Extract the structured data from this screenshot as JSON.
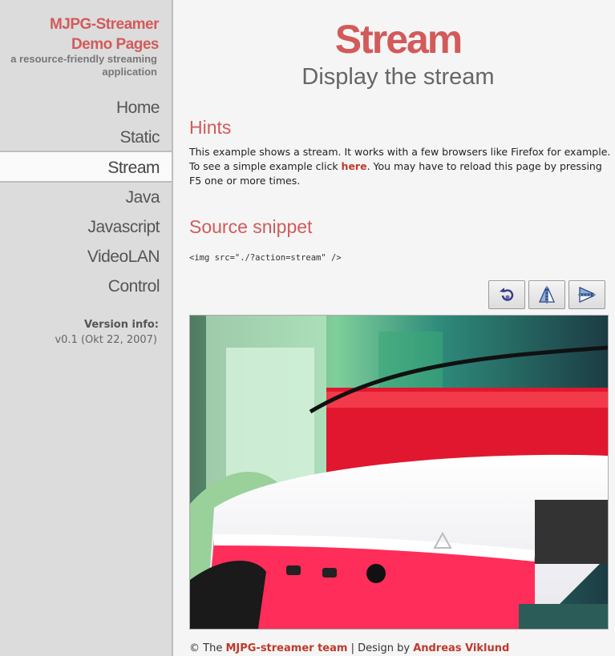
{
  "brand": {
    "title_line1": "MJPG-Streamer",
    "title_line2": "Demo Pages",
    "subtitle_line1": "a resource-friendly streaming",
    "subtitle_line2": "application"
  },
  "nav": {
    "items": [
      {
        "label": "Home"
      },
      {
        "label": "Static"
      },
      {
        "label": "Stream",
        "active": true
      },
      {
        "label": "Java"
      },
      {
        "label": "Javascript"
      },
      {
        "label": "VideoLAN"
      },
      {
        "label": "Control"
      }
    ]
  },
  "version": {
    "label": "Version info:",
    "value": "v0.1 (Okt 22, 2007)"
  },
  "page": {
    "title": "Stream",
    "subtitle": "Display the stream"
  },
  "hints": {
    "heading": "Hints",
    "text_before": "This example shows a stream. It works with a few browsers like Firefox for example. To see a simple example click ",
    "link": "here",
    "text_after": ". You may have to reload this page by pressing F5 one or more times."
  },
  "source": {
    "heading": "Source snippet",
    "code": "<img src=\"./?action=stream\" />"
  },
  "toolbar": {
    "buttons": [
      {
        "icon": "rotate-icon"
      },
      {
        "icon": "flip-vertical-icon"
      },
      {
        "icon": "flip-horizontal-icon"
      }
    ]
  },
  "stream": {
    "alt": "live camera stream"
  },
  "footer": {
    "prefix": "© The ",
    "team_link": "MJPG-streamer team",
    "middle": " | Design by ",
    "designer_link": "Andreas Viklund"
  },
  "colors": {
    "accent": "#d35a5a",
    "link": "#c0392b",
    "sidebar_bg": "#dcdcdc",
    "page_bg": "#f5f5f5"
  }
}
